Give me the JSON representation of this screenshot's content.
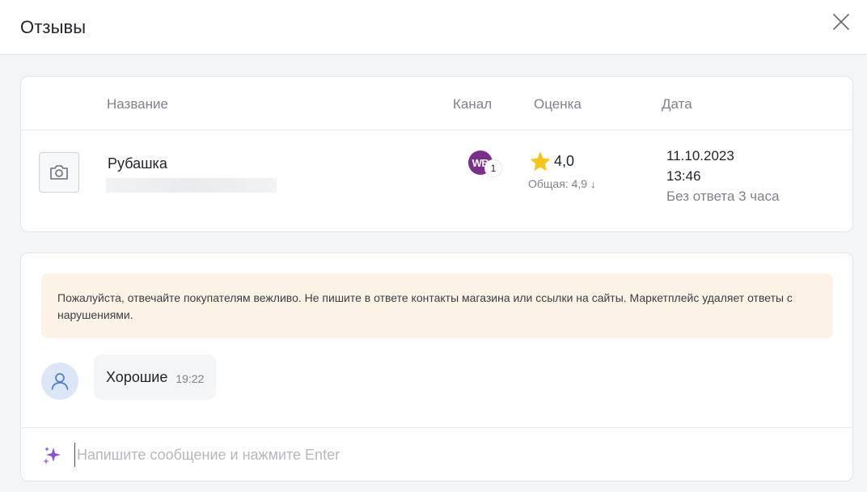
{
  "header": {
    "title": "Отзывы"
  },
  "table": {
    "columns": {
      "name": "Название",
      "channel": "Канал",
      "rating": "Оценка",
      "date": "Дата"
    },
    "row": {
      "product_name": "Рубашка",
      "channel_badge": "WB",
      "channel_count": "1",
      "rating": "4,0",
      "rating_total_label": "Общая: 4,9",
      "rating_trend": "↓",
      "date": "11.10.2023",
      "time": "13:46",
      "status": "Без ответа 3 часа"
    }
  },
  "chat": {
    "notice": "Пожалуйста, отвечайте покупателям вежливо. Не пишите в ответе контакты магазина или ссылки на сайты. Маркетплейс удаляет ответы с нарушениями.",
    "message": {
      "text": "Хорошие",
      "time": "19:22"
    },
    "input_placeholder": "Напишите сообщение и нажмите Enter"
  },
  "colors": {
    "channel_brand": "#7b2e8e",
    "notice_bg": "#fdf2e6",
    "star": "#f5c518",
    "trend_down": "#d9422e",
    "sparkle": "#8a4fd8"
  }
}
